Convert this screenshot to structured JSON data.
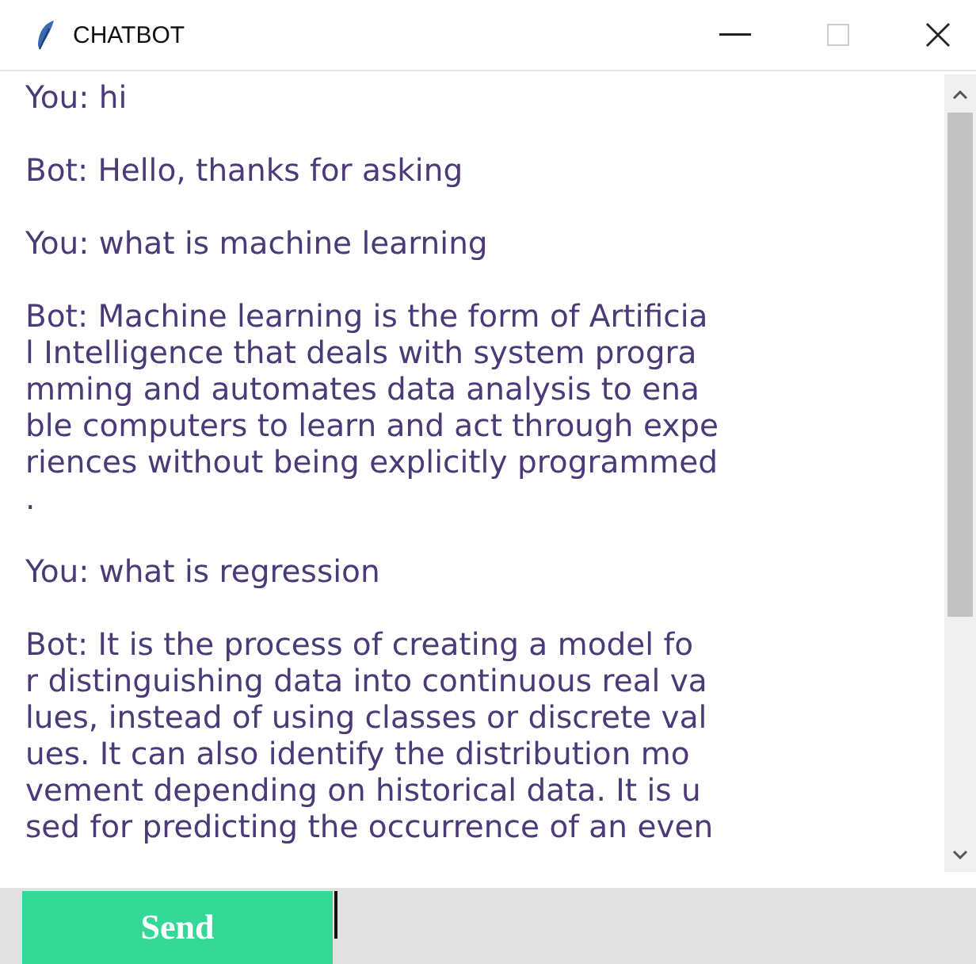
{
  "window": {
    "title": "CHATBOT"
  },
  "messages": [
    {
      "lines": [
        "You: hi"
      ]
    },
    {
      "lines": [
        "Bot: Hello, thanks for asking"
      ]
    },
    {
      "lines": [
        "You: what is machine learning"
      ]
    },
    {
      "lines": [
        "Bot: Machine learning is the form of Artificia",
        "l Intelligence that deals with system progra",
        "mming and automates data analysis to ena",
        "ble computers to learn and act through expe",
        "riences without being explicitly programmed",
        "."
      ]
    },
    {
      "lines": [
        "You: what is regression"
      ]
    },
    {
      "lines": [
        "Bot: It is the process of creating a model fo",
        "r distinguishing data into continuous real va",
        "lues, instead of using classes or discrete val",
        "ues. It can also identify the distribution mo",
        "vement depending on historical data. It is u",
        "sed for predicting the occurrence of an even"
      ]
    }
  ],
  "send_button": {
    "label": "Send"
  }
}
